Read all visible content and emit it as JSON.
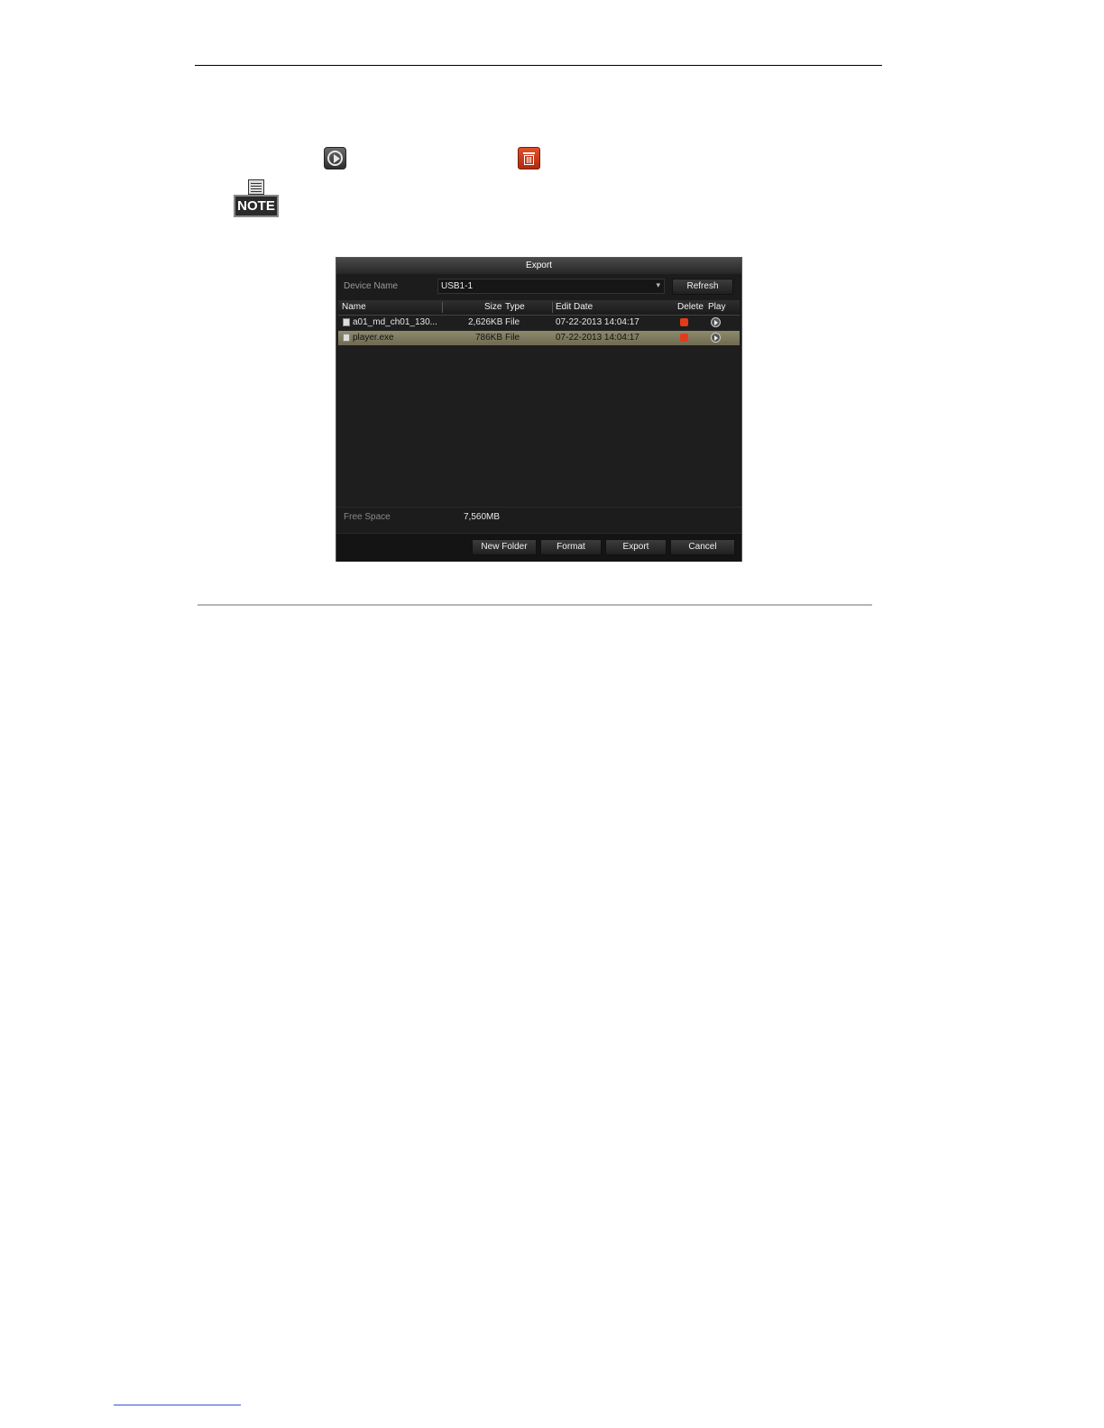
{
  "note": {
    "label": "NOTE"
  },
  "dialog": {
    "title": "Export",
    "device_label": "Device Name",
    "device_value": "USB1-1",
    "refresh_label": "Refresh",
    "columns": {
      "name": "Name",
      "size": "Size",
      "type": "Type",
      "edit_date": "Edit Date",
      "delete": "Delete",
      "play": "Play"
    },
    "files": [
      {
        "name": "a01_md_ch01_130...",
        "size": "2,626KB",
        "type": "File",
        "date": "07-22-2013 14:04:17"
      },
      {
        "name": "player.exe",
        "size": "786KB",
        "type": "File",
        "date": "07-22-2013 14:04:17"
      }
    ],
    "free_space_label": "Free Space",
    "free_space_value": "7,560MB",
    "buttons": {
      "new_folder": "New Folder",
      "format": "Format",
      "export": "Export",
      "cancel": "Cancel"
    },
    "colors": {
      "selected_row": "#8e8a6c",
      "delete_icon": "#e23b1c"
    }
  }
}
